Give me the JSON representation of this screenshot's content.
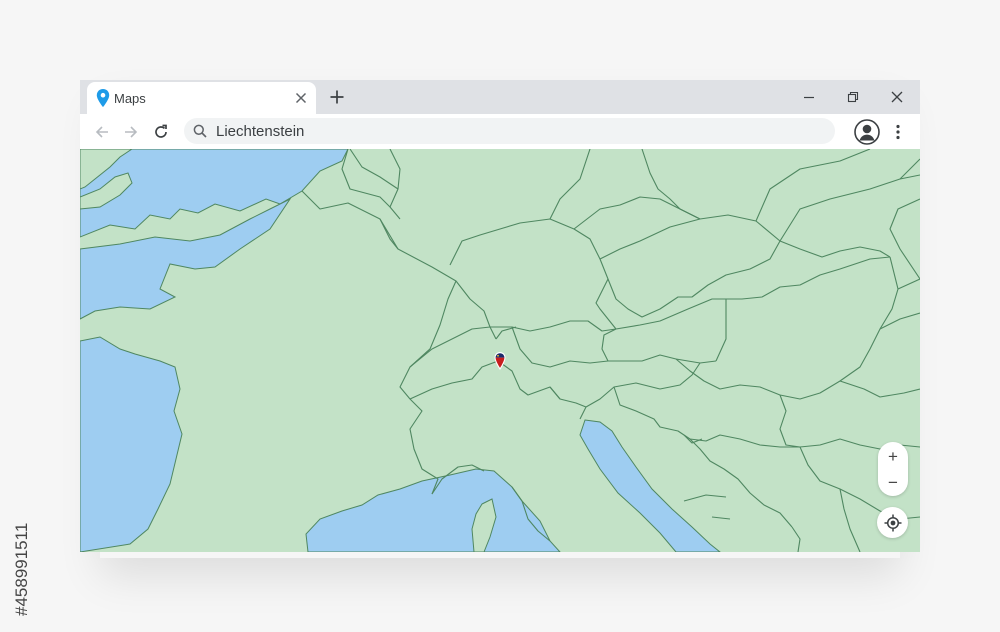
{
  "browser": {
    "tab": {
      "title": "Maps",
      "icon": "map-pin-icon",
      "close_icon": "close-icon"
    },
    "new_tab_icon": "plus-icon",
    "window_controls": [
      "minimize-icon",
      "restore-icon",
      "close-icon"
    ],
    "toolbar": {
      "back_icon": "arrow-left-icon",
      "forward_icon": "arrow-right-icon",
      "reload_icon": "reload-icon",
      "search_icon": "search-icon",
      "address_value": "Liechtenstein",
      "profile_icon": "account-icon",
      "menu_icon": "more-vertical-icon"
    }
  },
  "map": {
    "highlighted_country": "Liechtenstein",
    "controls": {
      "zoom_in": "+",
      "zoom_out": "−",
      "locate_icon": "my-location-icon"
    }
  },
  "stock_id": "#458991511",
  "colors": {
    "land": "#c3e2c7",
    "water": "#9ecdf1",
    "border": "#4f8761",
    "tab_bar": "#dfe1e5",
    "pin_blue": "#1e9be8",
    "pin_red": "#c81e1e",
    "pin_navy": "#1b2a6b"
  }
}
